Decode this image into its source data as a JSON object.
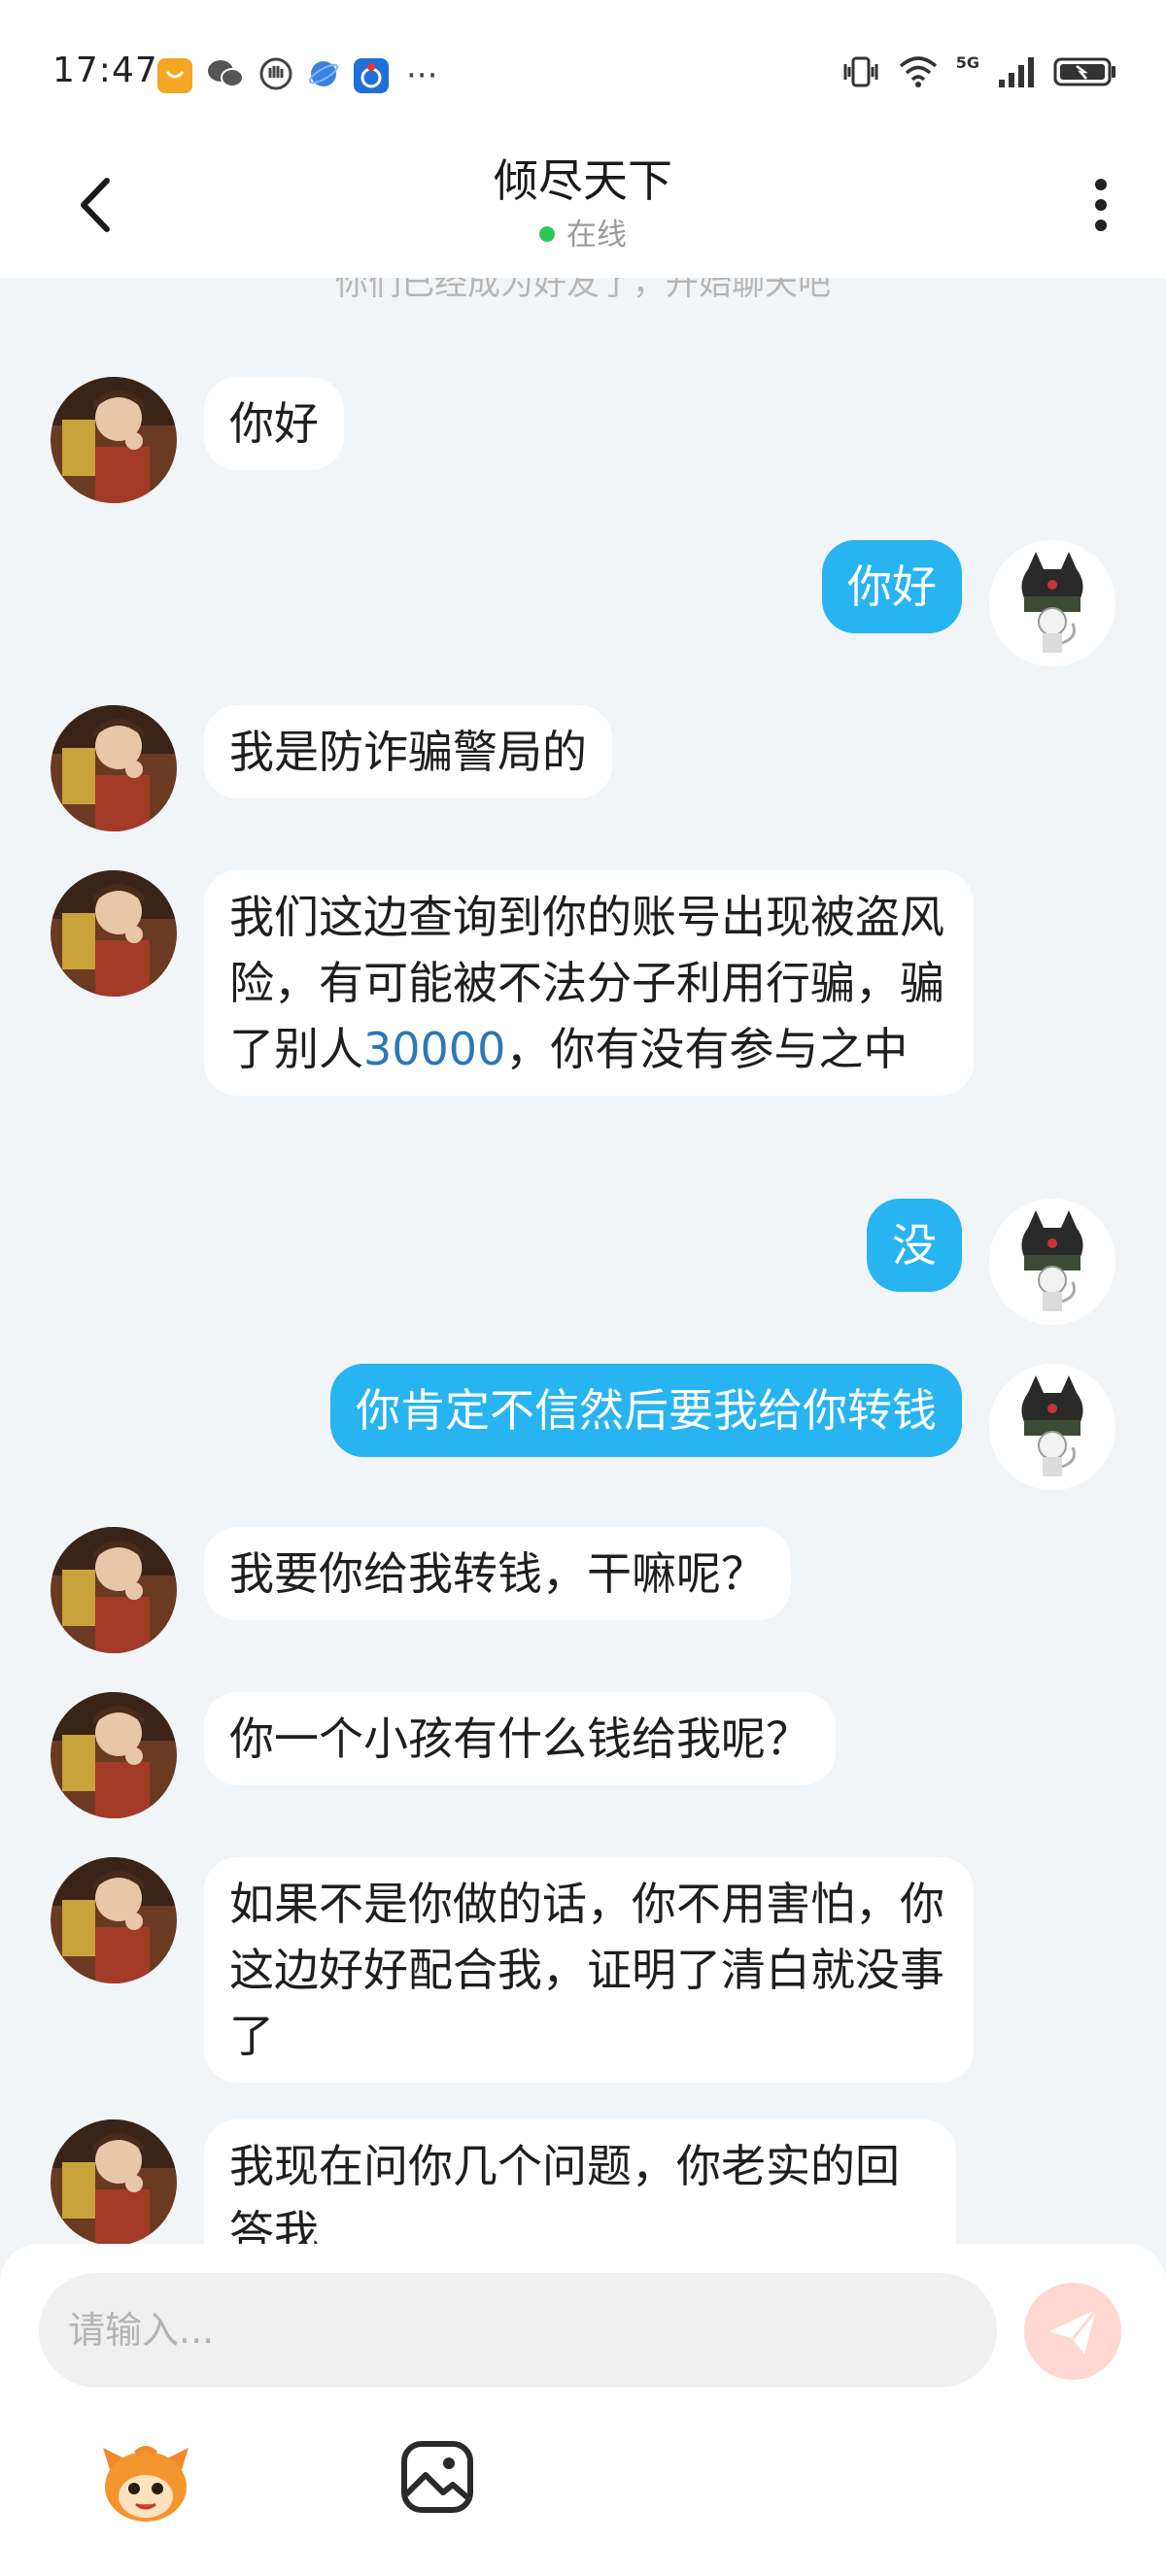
{
  "status_bar": {
    "time": "17:47",
    "more_indicator": "···",
    "network_label": "5G",
    "app_icons": [
      "shopping-icon",
      "wechat-icon",
      "hand-icon",
      "browser-icon",
      "app-icon"
    ],
    "right_icons": [
      "vibrate-icon",
      "wifi-icon",
      "signal-icon",
      "battery-icon"
    ]
  },
  "header": {
    "title": "倾尽天下",
    "status": "在线",
    "online_color": "#2fc653"
  },
  "chat": {
    "system_note": "你们已经成为好友了，开始聊天吧",
    "messages": [
      {
        "side": "left",
        "text": "你好"
      },
      {
        "side": "right",
        "text": "你好"
      },
      {
        "side": "left",
        "text": "我是防诈骗警局的"
      },
      {
        "side": "left",
        "text": "我们这边查询到你的账号出现被盗风险，有可能被不法分子利用行骗，骗了别人",
        "highlight": "30000",
        "text_after": "，你有没有参与之中"
      },
      {
        "side": "right",
        "text": "没"
      },
      {
        "side": "right",
        "text": "你肯定不信然后要我给你转钱"
      },
      {
        "side": "left",
        "text": "我要你给我转钱，干嘛呢？"
      },
      {
        "side": "left",
        "text": "你一个小孩有什么钱给我呢？"
      },
      {
        "side": "left",
        "text": "如果不是你做的话，你不用害怕，你这边好好配合我，证明了清白就没事了"
      },
      {
        "side": "left",
        "text": "我现在问你几个问题，你老实的回答我"
      }
    ]
  },
  "input": {
    "placeholder": "请输入...",
    "value": ""
  },
  "colors": {
    "outgoing_bubble": "#28b4f0",
    "incoming_bubble": "#ffffff",
    "chat_background": "#f2f5f8",
    "send_button": "#ffd8d2",
    "highlight_number": "#2b77b8"
  }
}
